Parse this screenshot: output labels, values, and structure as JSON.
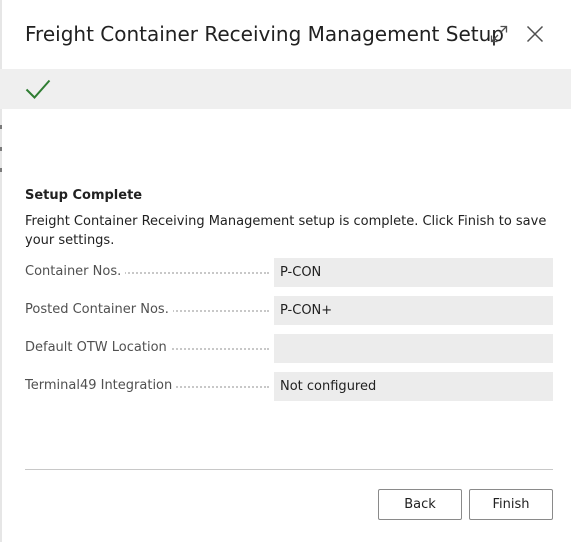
{
  "dialog": {
    "title": "Freight Container Receiving Management Setup",
    "expand_icon": "expand-diagonal-arrows",
    "close_icon": "close-x"
  },
  "banner": {
    "status_icon": "checkmark",
    "accent_color": "#2f7d32",
    "background": "#efefef"
  },
  "section": {
    "heading": "Setup Complete",
    "description": "Freight Container Receiving Management setup is complete. Click Finish to save your settings."
  },
  "fields": [
    {
      "label": "Container Nos.",
      "value": "P-CON"
    },
    {
      "label": "Posted Container Nos.",
      "value": "P-CON+"
    },
    {
      "label": "Default OTW Location",
      "value": ""
    },
    {
      "label": "Terminal49 Integration",
      "value": "Not configured"
    }
  ],
  "footer": {
    "back_label": "Back",
    "finish_label": "Finish"
  }
}
